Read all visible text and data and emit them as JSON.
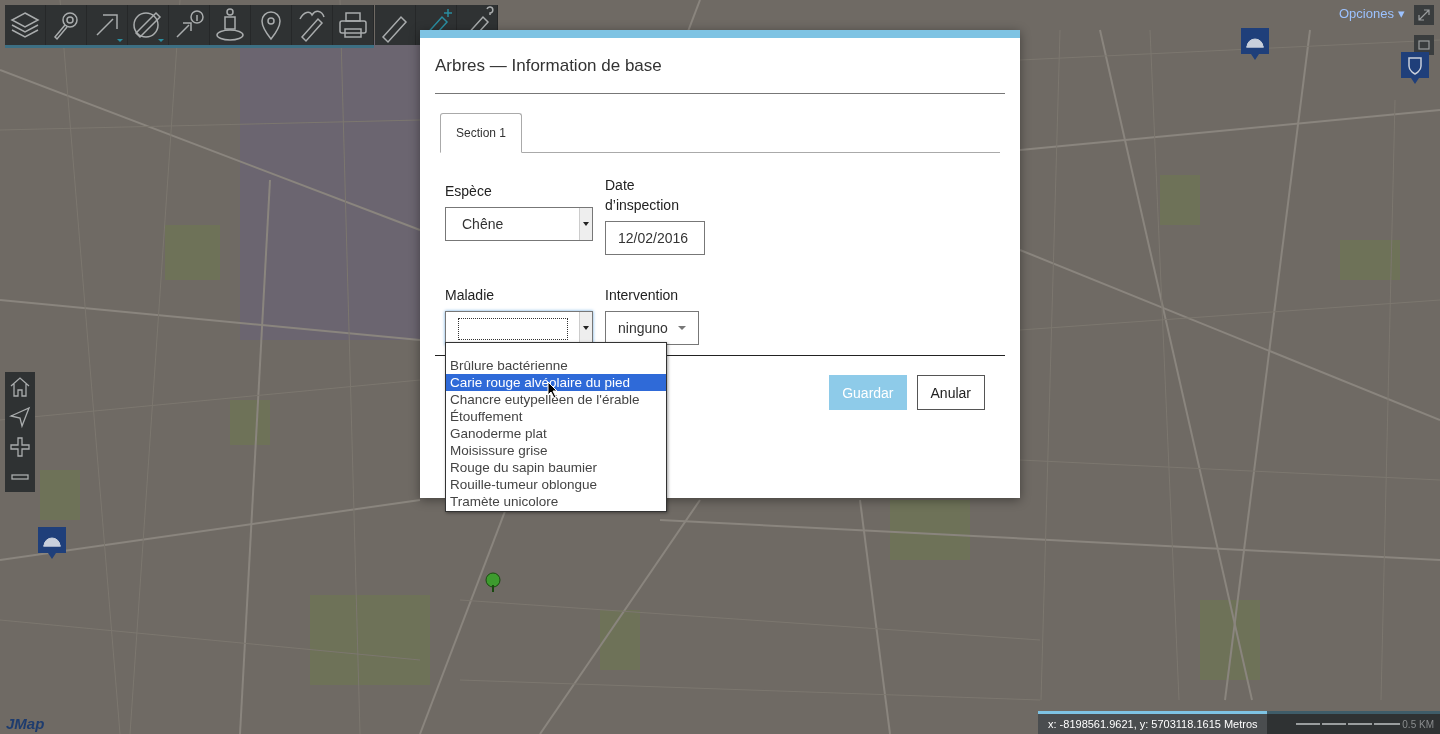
{
  "top_right": {
    "options_menu": "Opciones ▾"
  },
  "dialog": {
    "title": "Arbres — Information de base",
    "tabs": [
      {
        "label": "Section 1",
        "selected": true
      }
    ],
    "fields": [
      {
        "kind": "select",
        "label": "Espèce",
        "value": "Chêne"
      },
      {
        "kind": "text",
        "label": "Date d’inspection",
        "value": "12/02/2016"
      },
      {
        "kind": "select",
        "label": "Maladie",
        "focused": true
      },
      {
        "kind": "menu",
        "label": "Intervention",
        "value": "ninguno"
      }
    ],
    "dropdown_options": [
      {
        "label": "Brûlure bactérienne",
        "selected": false
      },
      {
        "label": "Carie rouge alvéolaire du pied",
        "selected": true
      },
      {
        "label": "Chancre eutypelléen de l'érable",
        "selected": false
      },
      {
        "label": "Étouffement",
        "selected": false
      },
      {
        "label": "Ganoderme plat",
        "selected": false
      },
      {
        "label": "Moisissure grise",
        "selected": false
      },
      {
        "label": "Rouge du sapin baumier",
        "selected": false
      },
      {
        "label": "Rouille-tumeur oblongue",
        "selected": false
      },
      {
        "label": "Tramète unicolore",
        "selected": false
      }
    ],
    "buttons": [
      {
        "label": "Guardar",
        "kind": "primary",
        "disabled": true
      },
      {
        "label": "Anular",
        "kind": "secondary",
        "disabled": false
      }
    ]
  },
  "status_bar": {
    "coordinates": "x: -8198561.9621, y: 5703118.1615 Metros",
    "scale": "0.5 KM"
  },
  "logo": "JMap"
}
